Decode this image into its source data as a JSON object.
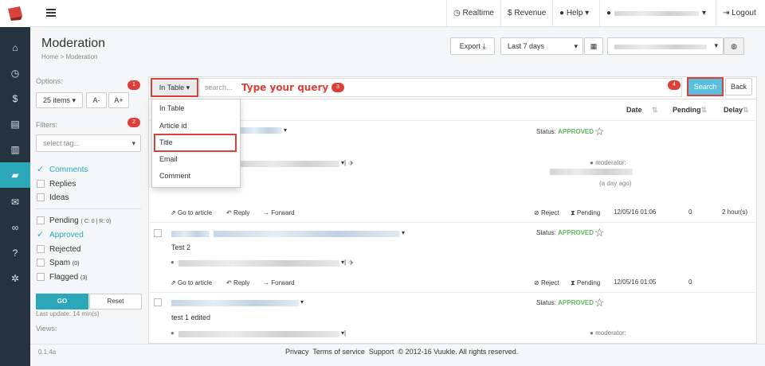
{
  "topbar": {
    "realtime": "Realtime",
    "revenue": "Revenue",
    "help": "Help",
    "logout": "Logout"
  },
  "header": {
    "title": "Moderation",
    "breadcrumb_home": "Home",
    "breadcrumb_sep": ">",
    "breadcrumb_current": "Moderation",
    "export": "Export",
    "range": "Last 7 days"
  },
  "filters": {
    "options_label": "Options:",
    "items_per_page": "25 items",
    "font_smaller": "A-",
    "font_larger": "A+",
    "filters_label": "Filters:",
    "tag_placeholder": "select tag...",
    "types": [
      {
        "label": "Comments",
        "checked": true
      },
      {
        "label": "Replies",
        "checked": false
      },
      {
        "label": "Ideas",
        "checked": false
      }
    ],
    "pending_label": "Pending",
    "pending_counts": "( C: 0 | R: 0)",
    "approved_label": "Approved",
    "rejected_label": "Rejected",
    "spam_label": "Spam",
    "spam_count": "(0)",
    "flagged_label": "Flagged",
    "flagged_count": "(3)",
    "go": "GO",
    "reset": "Reset",
    "last_update": "Last update: 14 min(s)",
    "views_label": "Views:"
  },
  "search": {
    "scope": "In Table",
    "placeholder": "search...",
    "annotation": "Type your query",
    "search_btn": "Search",
    "back_btn": "Back",
    "dropdown_items": [
      "In Table",
      "Article id",
      "Title",
      "Email",
      "Comment"
    ]
  },
  "markers": [
    "1",
    "2",
    "3",
    "4"
  ],
  "table": {
    "col_date": "Date",
    "col_pending": "Pending",
    "col_delay": "Delay",
    "status_prefix": "Status:",
    "status_value": "APPROVED",
    "moderator_label": "moderator:",
    "go_to_article": "Go to article",
    "reply": "Reply",
    "forward": "Forward",
    "reject": "Reject",
    "pending": "Pending",
    "rows": [
      {
        "text": "",
        "date": "12/05/16 01:06",
        "pending": "0",
        "delay": "2 hour(s)",
        "ago": "(a day ago)"
      },
      {
        "text": "Test 2",
        "date": "12/05/16 01:05",
        "pending": "0",
        "delay": ""
      },
      {
        "text": "test 1 edited",
        "date": "",
        "pending": "",
        "delay": ""
      }
    ]
  },
  "footer": {
    "version": "0.1.4a",
    "privacy": "Privacy",
    "terms": "Terms of service",
    "support": "Support",
    "copyright": "© 2012-16 Vuukle. All rights reserved."
  },
  "colors": {
    "sidebar": "#24333f",
    "accent": "#2aa7b9",
    "annotation_red": "#d9413a",
    "approved_green": "#5cb85c",
    "search_button": "#5bc0de"
  }
}
